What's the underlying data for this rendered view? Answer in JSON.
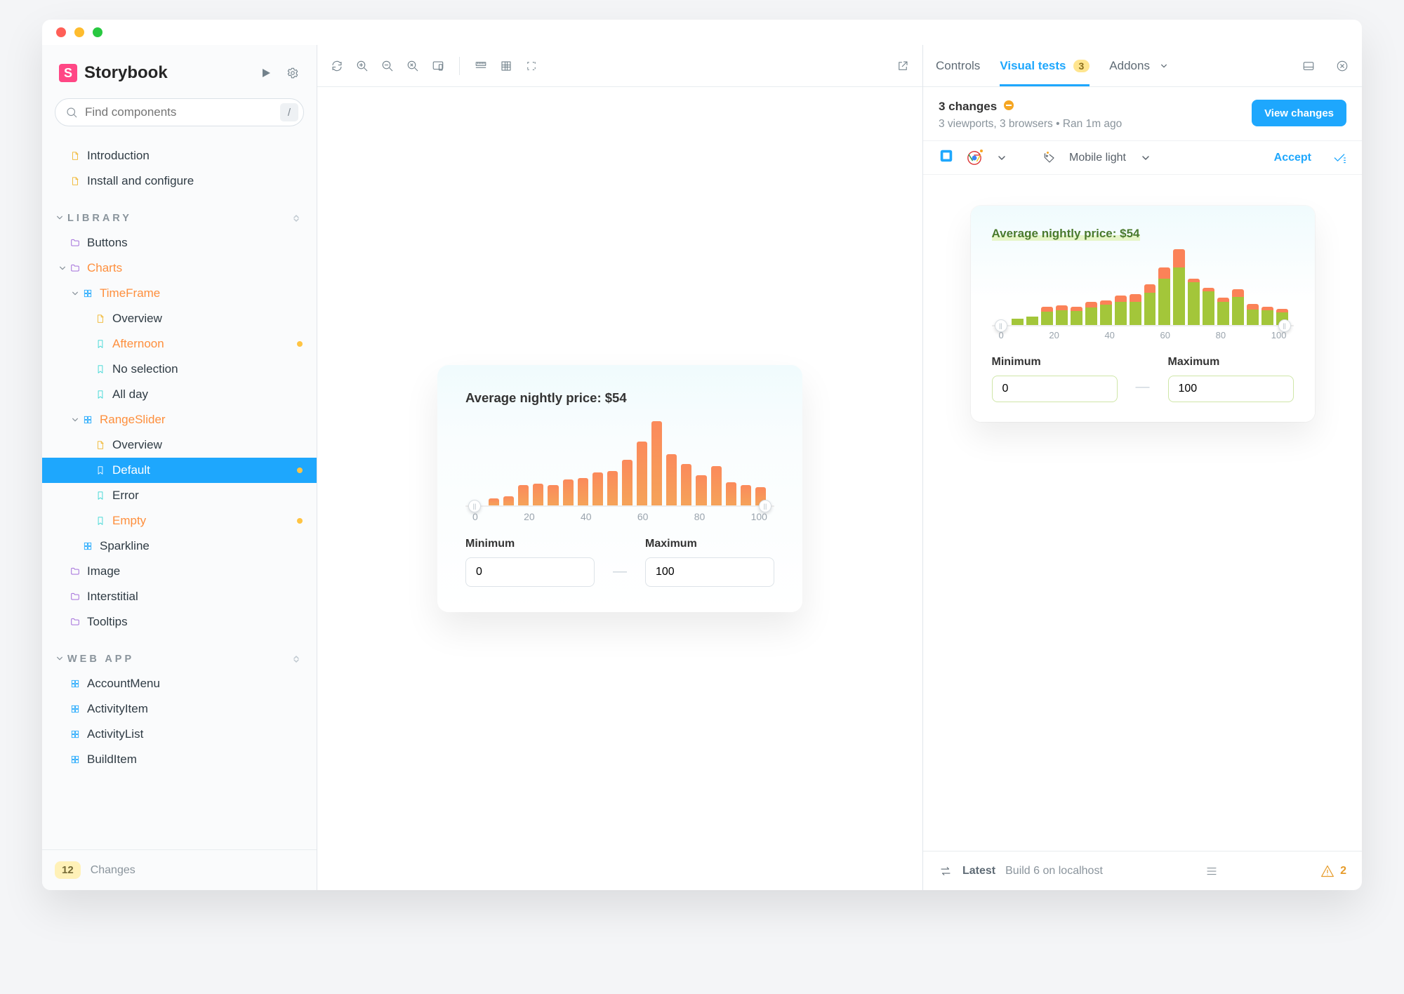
{
  "app": {
    "title": "Storybook"
  },
  "search": {
    "placeholder": "Find components",
    "shortcut": "/"
  },
  "sidebar": {
    "top_docs": [
      "Introduction",
      "Install and configure"
    ],
    "sections": [
      {
        "name": "LIBRARY",
        "items": [
          {
            "type": "folder",
            "label": "Buttons"
          },
          {
            "type": "folder",
            "label": "Charts",
            "open": true,
            "hot": true,
            "children": [
              {
                "type": "component",
                "label": "TimeFrame",
                "open": true,
                "hot": true,
                "children": [
                  {
                    "type": "doc",
                    "label": "Overview"
                  },
                  {
                    "type": "story",
                    "label": "Afternoon",
                    "hot": true,
                    "dot": true
                  },
                  {
                    "type": "story",
                    "label": "No selection"
                  },
                  {
                    "type": "story",
                    "label": "All day"
                  }
                ]
              },
              {
                "type": "component",
                "label": "RangeSlider",
                "open": true,
                "hot": true,
                "children": [
                  {
                    "type": "doc",
                    "label": "Overview"
                  },
                  {
                    "type": "story",
                    "label": "Default",
                    "hot": true,
                    "selected": true,
                    "dot": true
                  },
                  {
                    "type": "story",
                    "label": "Error"
                  },
                  {
                    "type": "story",
                    "label": "Empty",
                    "hot": true,
                    "dot": true
                  }
                ]
              },
              {
                "type": "component",
                "label": "Sparkline"
              }
            ]
          },
          {
            "type": "folder",
            "label": "Image"
          },
          {
            "type": "folder",
            "label": "Interstitial"
          },
          {
            "type": "folder",
            "label": "Tooltips"
          }
        ]
      },
      {
        "name": "WEB APP",
        "items": [
          {
            "type": "component",
            "label": "AccountMenu"
          },
          {
            "type": "component",
            "label": "ActivityItem"
          },
          {
            "type": "component",
            "label": "ActivityList"
          },
          {
            "type": "component",
            "label": "BuildItem"
          }
        ]
      }
    ],
    "footer": {
      "count": "12",
      "label": "Changes"
    }
  },
  "toolbar": {
    "icons": [
      "sync",
      "zoom-in",
      "zoom-out",
      "zoom-reset",
      "viewport",
      "sep",
      "measure",
      "grid",
      "outline",
      "spacer",
      "open-external"
    ]
  },
  "canvas_card": {
    "title": "Average nightly price: $54",
    "min_label": "Minimum",
    "max_label": "Maximum",
    "min_value": "0",
    "max_value": "100"
  },
  "addons": {
    "tabs": [
      {
        "label": "Controls",
        "active": false
      },
      {
        "label": "Visual tests",
        "active": true,
        "badge": "3"
      },
      {
        "label": "Addons",
        "active": false,
        "caret": true
      }
    ],
    "summary": {
      "title": "3 changes",
      "sub": "3 viewports, 3 browsers • Ran 1m ago",
      "button": "View changes"
    },
    "filters": {
      "viewport": "Mobile light",
      "accept": "Accept"
    },
    "snapshot_card": {
      "title": "Average nightly price: $54",
      "min_label": "Minimum",
      "max_label": "Maximum",
      "min_value": "0",
      "max_value": "100"
    },
    "footer": {
      "latest": "Latest",
      "build": "Build 6 on localhost",
      "warn_count": "2"
    }
  },
  "chart_data": {
    "canvas": {
      "type": "bar",
      "title": "Average nightly price: $54",
      "xlabel": "",
      "ylabel": "",
      "ylim": [
        0,
        100
      ],
      "xlim": [
        0,
        100
      ],
      "ticks": [
        0,
        20,
        40,
        60,
        80,
        100
      ],
      "x": [
        2.5,
        7.5,
        12.5,
        17.5,
        22.5,
        27.5,
        32.5,
        37.5,
        42.5,
        47.5,
        52.5,
        57.5,
        62.5,
        67.5,
        72.5,
        77.5,
        82.5,
        87.5,
        92.5,
        97.5
      ],
      "values": [
        0,
        8,
        11,
        24,
        25,
        24,
        30,
        32,
        38,
        40,
        53,
        74,
        98,
        60,
        48,
        35,
        46,
        27,
        24,
        21
      ],
      "range_selection": {
        "min": 0,
        "max": 100
      }
    },
    "snapshot": {
      "type": "bar-stacked",
      "title": "Average nightly price: $54",
      "ticks": [
        0,
        20,
        40,
        60,
        80,
        100
      ],
      "x": [
        2.5,
        7.5,
        12.5,
        17.5,
        22.5,
        27.5,
        32.5,
        37.5,
        42.5,
        47.5,
        52.5,
        57.5,
        62.5,
        67.5,
        72.5,
        77.5,
        82.5,
        87.5,
        92.5,
        97.5
      ],
      "series": [
        {
          "name": "baseline",
          "color": "#a3c63a",
          "values": [
            0,
            8,
            11,
            17,
            19,
            18,
            23,
            26,
            30,
            30,
            42,
            60,
            74,
            55,
            44,
            30,
            36,
            20,
            19,
            16
          ]
        },
        {
          "name": "diff",
          "color": "#fb8258",
          "values": [
            0,
            0,
            0,
            7,
            6,
            6,
            7,
            6,
            8,
            10,
            11,
            14,
            24,
            5,
            4,
            5,
            10,
            7,
            5,
            5
          ]
        }
      ],
      "range_selection": {
        "min": 0,
        "max": 100
      }
    }
  }
}
